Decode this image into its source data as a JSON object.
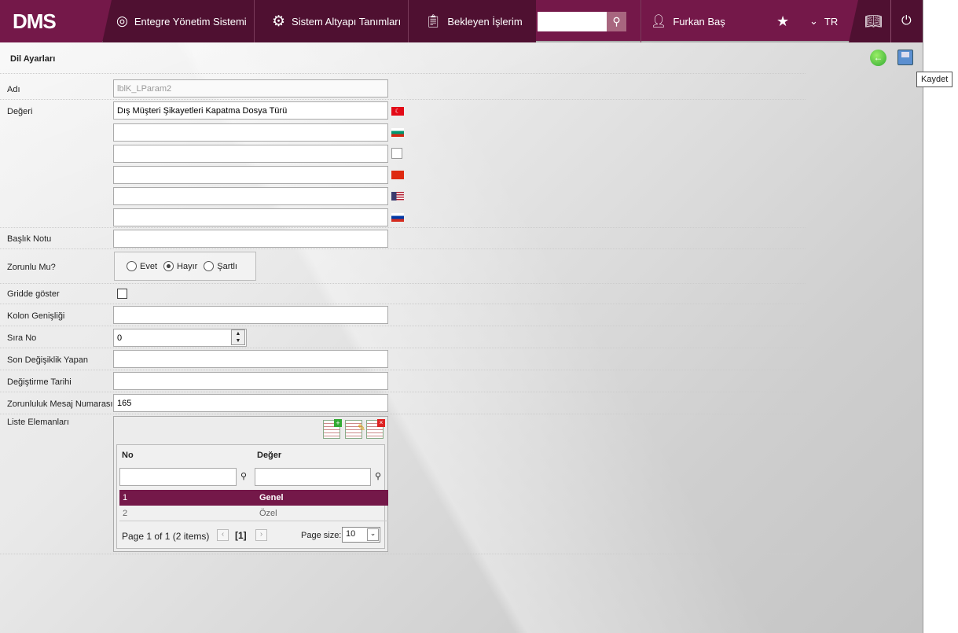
{
  "header": {
    "logo": "DMS",
    "nav": [
      {
        "label": "Entegre Yönetim Sistemi",
        "icon": "q-logo-icon"
      },
      {
        "label": "Sistem Altyapı Tanımları",
        "icon": "gear-icon"
      },
      {
        "label": "Bekleyen İşlerim",
        "icon": "clipboard-icon"
      }
    ],
    "search_value": "",
    "user": "Furkan Baş",
    "language": "TR"
  },
  "page": {
    "title": "Dil Ayarları",
    "save_tooltip": "Kaydet"
  },
  "form": {
    "name_label": "Adı",
    "name_value": "lblK_LParam2",
    "value_label": "Değeri",
    "value_tr": "Dış Müşteri Şikayetleri Kapatma Dosya Türü",
    "lang_values": [
      "",
      "",
      "",
      "",
      ""
    ],
    "title_note_label": "Başlık Notu",
    "title_note_value": "",
    "required_label": "Zorunlu Mu?",
    "required_options": [
      "Evet",
      "Hayır",
      "Şartlı"
    ],
    "required_selected": "Hayır",
    "grid_show_label": "Gridde göster",
    "grid_show_checked": false,
    "col_width_label": "Kolon Genişliği",
    "col_width_value": "",
    "order_label": "Sıra No",
    "order_value": "0",
    "modified_by_label": "Son Değişiklik Yapan",
    "modified_by_value": "",
    "modified_date_label": "Değiştirme Tarihi",
    "modified_date_value": "",
    "msg_no_label": "Zorunluluk Mesaj Numarası",
    "msg_no_value": "165",
    "list_label": "Liste Elemanları"
  },
  "grid": {
    "columns": [
      "No",
      "Değer"
    ],
    "rows": [
      [
        "1",
        "Genel"
      ],
      [
        "2",
        "Özel"
      ]
    ],
    "selected_row": 0,
    "pager": "Page 1 of 1 (2 items)",
    "current_page": "[1]",
    "page_size_label": "Page size:",
    "page_size": "10"
  },
  "colors": {
    "brand": "#741849",
    "brand_dark": "#4f1031"
  }
}
